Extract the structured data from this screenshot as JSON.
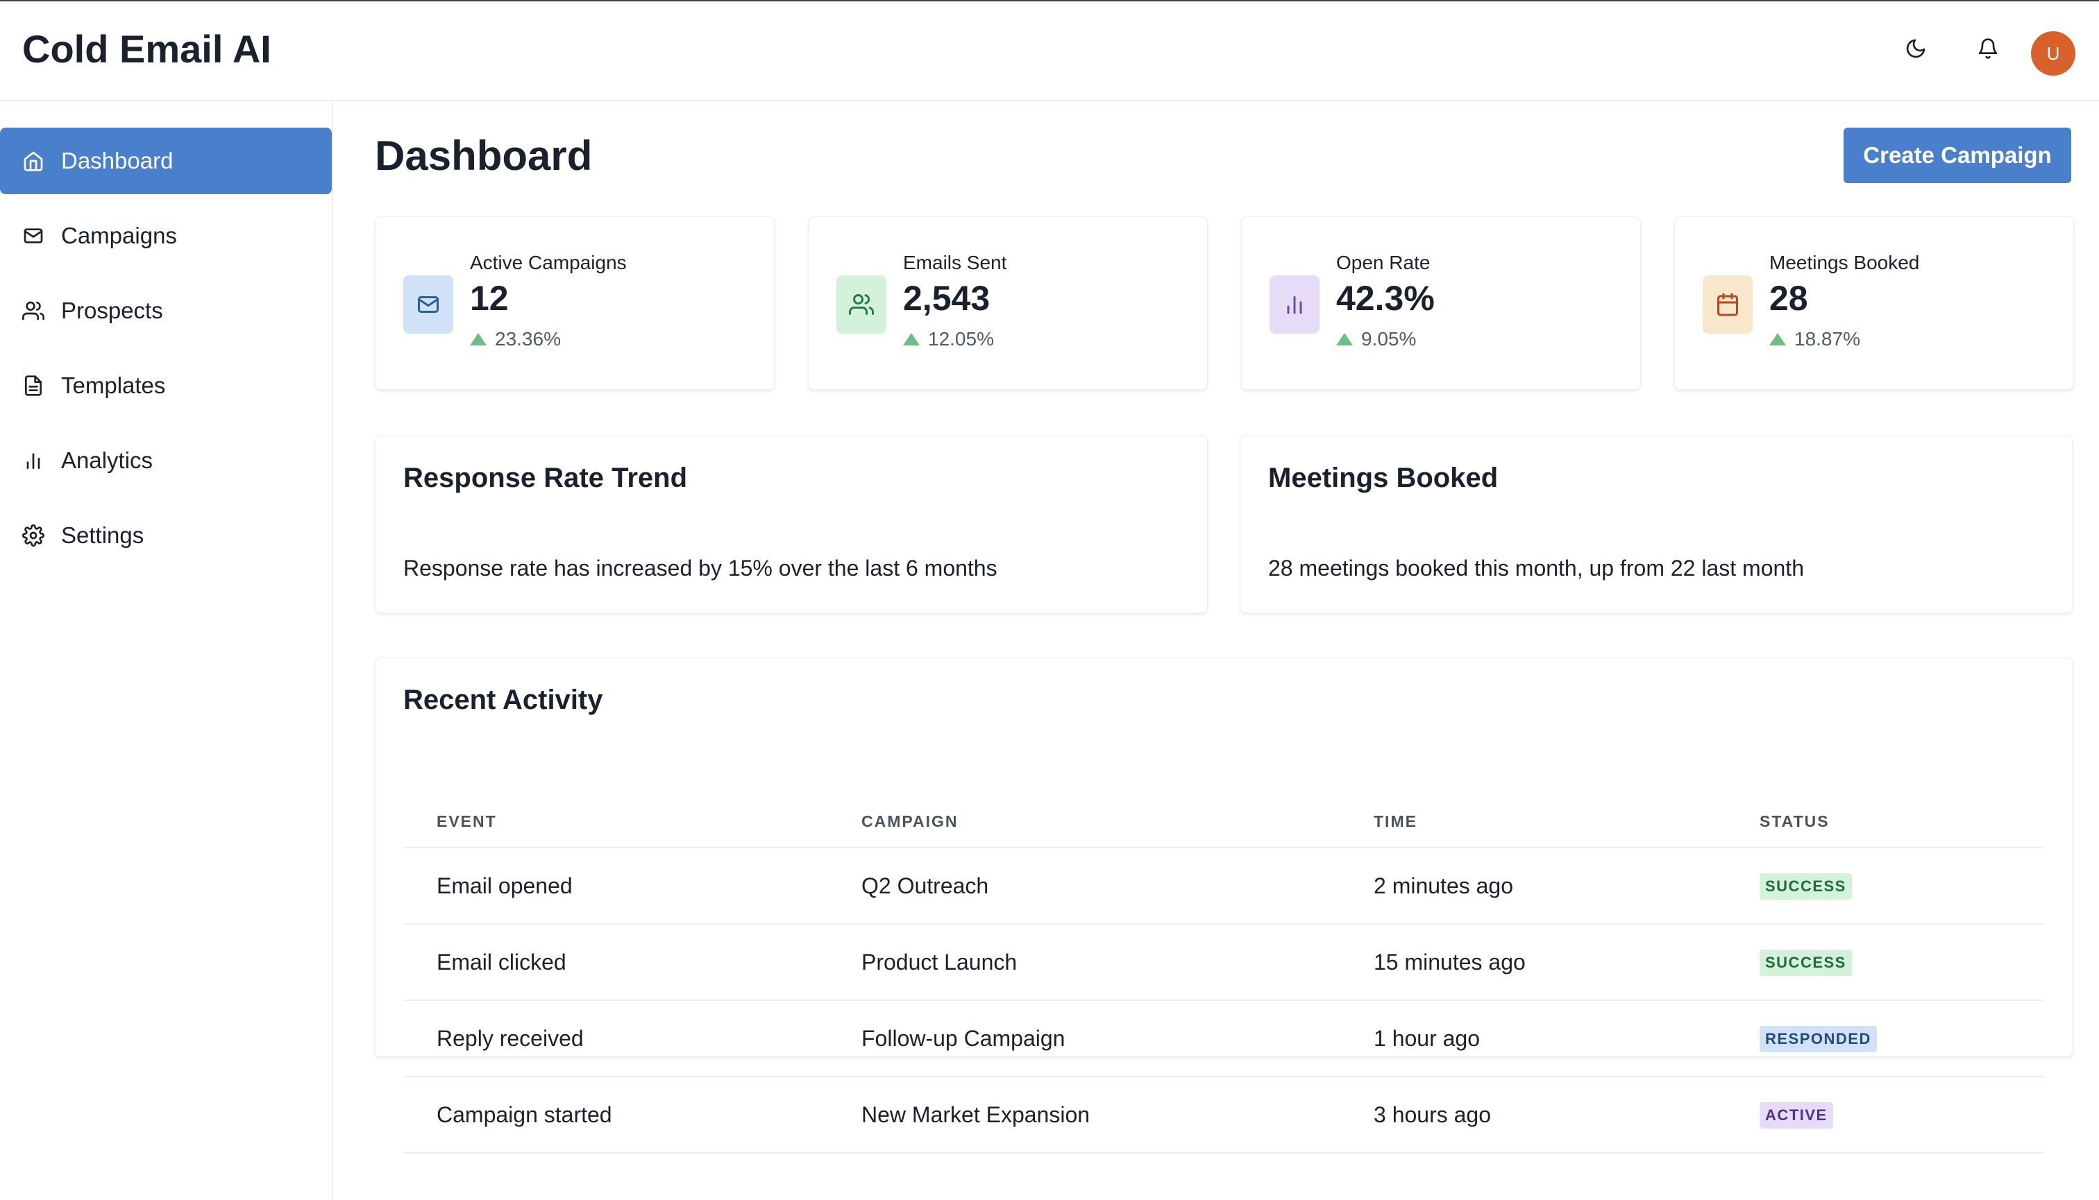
{
  "app": {
    "title": "Cold Email AI"
  },
  "header": {
    "user_initial": "U"
  },
  "sidebar": {
    "items": [
      {
        "label": "Dashboard",
        "icon": "home-icon",
        "active": true
      },
      {
        "label": "Campaigns",
        "icon": "mail-icon"
      },
      {
        "label": "Prospects",
        "icon": "users-icon"
      },
      {
        "label": "Templates",
        "icon": "file-text-icon"
      },
      {
        "label": "Analytics",
        "icon": "bar-chart-icon"
      },
      {
        "label": "Settings",
        "icon": "gear-icon"
      }
    ]
  },
  "main": {
    "title": "Dashboard",
    "create_button": "Create Campaign",
    "stats": [
      {
        "label": "Active Campaigns",
        "value": "12",
        "delta": "23.36%",
        "icon": "mail-icon",
        "bg": "#cfe2f7",
        "color": "#2c5d9c"
      },
      {
        "label": "Emails Sent",
        "value": "2,543",
        "delta": "12.05%",
        "icon": "users-icon",
        "bg": "#d4f1dc",
        "color": "#2c7a45"
      },
      {
        "label": "Open Rate",
        "value": "42.3%",
        "delta": "9.05%",
        "icon": "bar-chart-icon",
        "bg": "#e6dcf7",
        "color": "#6b4aa8"
      },
      {
        "label": "Meetings Booked",
        "value": "28",
        "delta": "18.87%",
        "icon": "calendar-icon",
        "bg": "#f9e7cc",
        "color": "#b34a1f"
      }
    ],
    "panels": [
      {
        "title": "Response Rate Trend",
        "text": "Response rate has increased by 15% over the last 6 months"
      },
      {
        "title": "Meetings Booked",
        "text": "28 meetings booked this month, up from 22 last month"
      }
    ],
    "activity": {
      "title": "Recent Activity",
      "columns": [
        "EVENT",
        "CAMPAIGN",
        "TIME",
        "STATUS"
      ],
      "rows": [
        {
          "event": "Email opened",
          "campaign": "Q2 Outreach",
          "time": "2 minutes ago",
          "status": "SUCCESS"
        },
        {
          "event": "Email clicked",
          "campaign": "Product Launch",
          "time": "15 minutes ago",
          "status": "SUCCESS"
        },
        {
          "event": "Reply received",
          "campaign": "Follow-up Campaign",
          "time": "1 hour ago",
          "status": "RESPONDED"
        },
        {
          "event": "Campaign started",
          "campaign": "New Market Expansion",
          "time": "3 hours ago",
          "status": "ACTIVE"
        }
      ],
      "status_colors": {
        "SUCCESS": {
          "bg": "#d4f1dc",
          "fg": "#1f6b3a"
        },
        "RESPONDED": {
          "bg": "#cfe2f7",
          "fg": "#24497a"
        },
        "ACTIVE": {
          "bg": "#e6dcf7",
          "fg": "#4e3386"
        }
      }
    }
  }
}
